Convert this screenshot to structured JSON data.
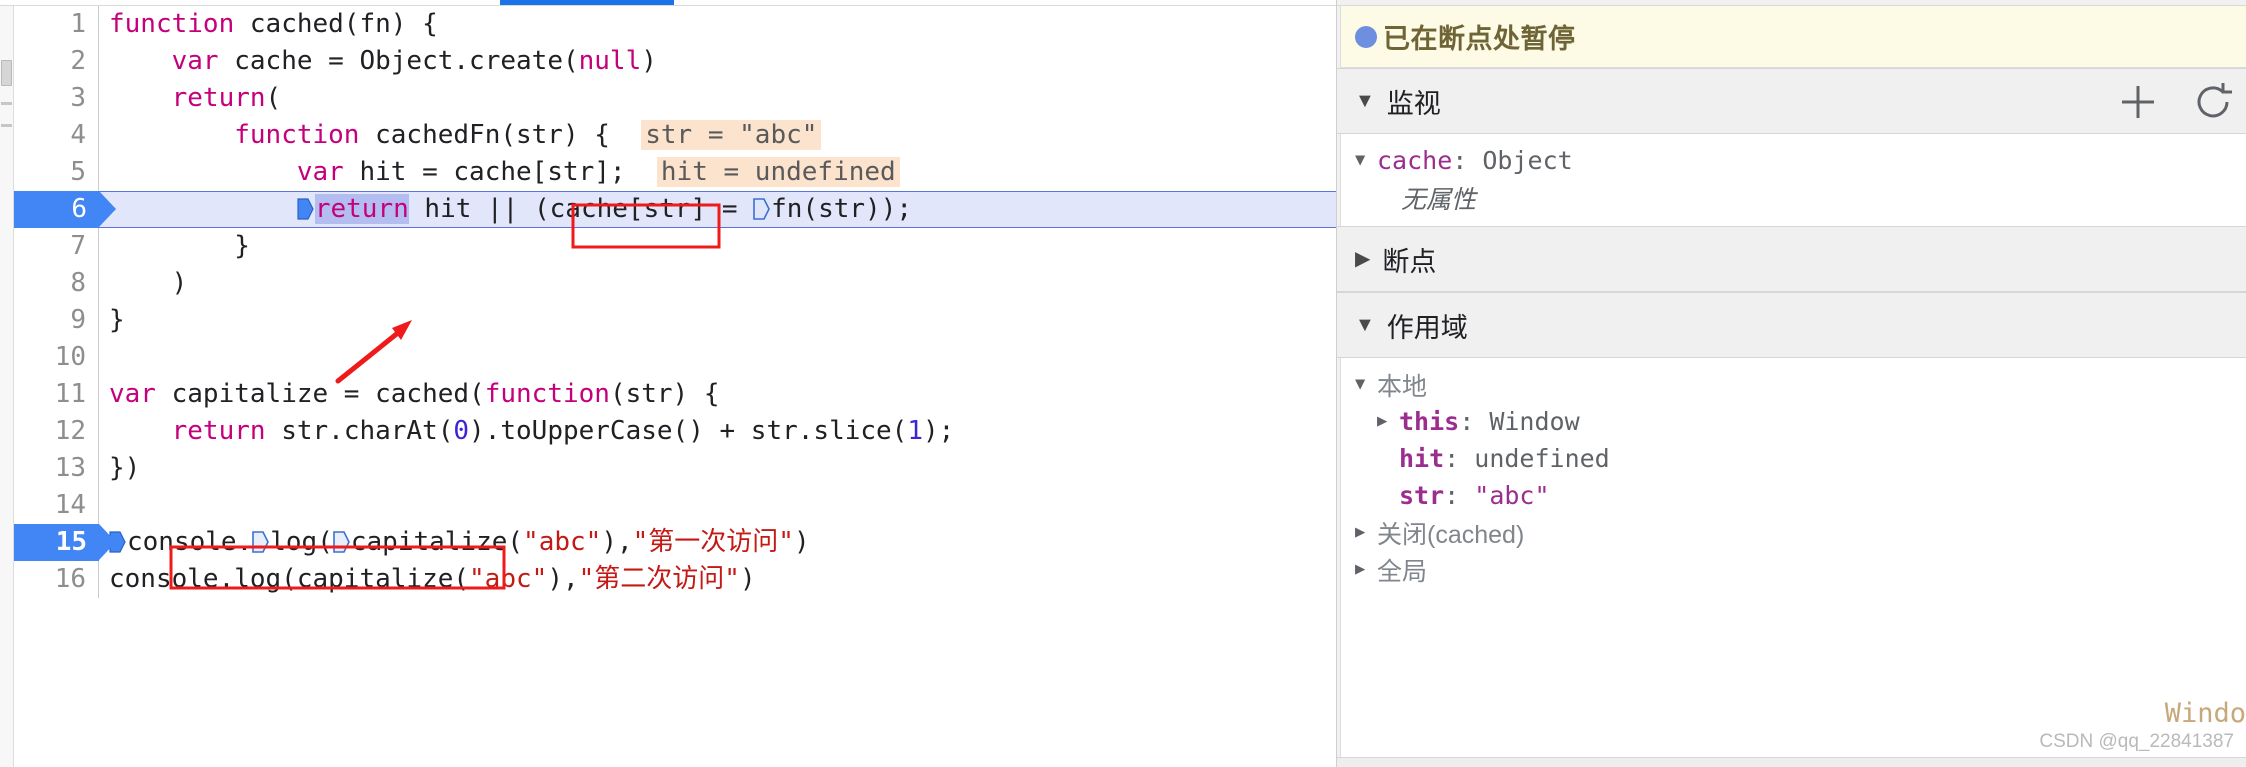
{
  "editor": {
    "language": "javascript",
    "execution_line": 6,
    "breakpoint_lines": [
      6,
      15
    ],
    "lines": [
      {
        "n": "1",
        "text": "function cached(fn) {"
      },
      {
        "n": "2",
        "text": "    var cache = Object.create(null)"
      },
      {
        "n": "3",
        "text": "    return("
      },
      {
        "n": "4",
        "text": "        function cachedFn(str) {",
        "hint": "str = \"abc\""
      },
      {
        "n": "5",
        "text": "            var hit = cache[str];",
        "hint": "hit = undefined"
      },
      {
        "n": "6",
        "text": "            return hit || (cache[str] = fn(str));"
      },
      {
        "n": "7",
        "text": "        }"
      },
      {
        "n": "8",
        "text": "    )"
      },
      {
        "n": "9",
        "text": "}"
      },
      {
        "n": "10",
        "text": ""
      },
      {
        "n": "11",
        "text": "var capitalize = cached(function(str) {"
      },
      {
        "n": "12",
        "text": "    return str.charAt(0).toUpperCase() + str.slice(1);"
      },
      {
        "n": "13",
        "text": "})"
      },
      {
        "n": "14",
        "text": ""
      },
      {
        "n": "15",
        "text": "console.log(capitalize(\"abc\"),\"第一次访问\")"
      },
      {
        "n": "16",
        "text": "console.log(capitalize(\"abc\"),\"第二次访问\")"
      }
    ],
    "inline_hints": [
      {
        "line": 4,
        "text": "str = \"abc\""
      },
      {
        "line": 5,
        "text": "hit = undefined"
      }
    ],
    "annotations": [
      {
        "name": "red-box-fn-call",
        "line": 6,
        "note": "fn(str)"
      },
      {
        "name": "red-box-console-log",
        "line": 15,
        "note": "console.log(capitalize(\"abc\")"
      },
      {
        "name": "red-arrow",
        "note": "points to toUpperCase() on line 12"
      }
    ]
  },
  "sidebar": {
    "paused_banner": {
      "text": "已在断点处暂停",
      "dot_color": "#6e8fe0",
      "background": "#fdfae5"
    },
    "watch": {
      "title": "监视",
      "add_label": "+",
      "refresh_label": "↻",
      "entries": [
        {
          "name": "cache",
          "separator": ": ",
          "value": "Object",
          "expanded": true,
          "children": [
            {
              "text": "无属性",
              "italic": true
            }
          ]
        }
      ]
    },
    "breakpoints": {
      "title": "断点",
      "expanded": false
    },
    "scope": {
      "title": "作用域",
      "expanded": true,
      "groups": [
        {
          "label": "本地",
          "expanded": true,
          "rows": [
            {
              "twisty": "closed",
              "name": "this",
              "separator": ": ",
              "value": "Window",
              "value_kind": "plain",
              "indent": 1
            },
            {
              "twisty": "blank",
              "name": "hit",
              "separator": ": ",
              "value": "undefined",
              "value_kind": "plain",
              "indent": 1,
              "bold": true
            },
            {
              "twisty": "blank",
              "name": "str",
              "separator": ": ",
              "value": "\"abc\"",
              "value_kind": "string",
              "indent": 1,
              "bold": true
            }
          ]
        },
        {
          "label": "关闭(cached)",
          "expanded": false,
          "rows": []
        },
        {
          "label": "全局",
          "expanded": false,
          "rows": []
        }
      ]
    },
    "global_hint_text": "Windo",
    "watermark": "CSDN @qq_22841387"
  },
  "colors": {
    "accent_blue": "#4285f4",
    "exec_line_bg": "#e2e6fb",
    "hint_bg": "#fbe3ce",
    "keyword": "#c5007c",
    "string": "#c41a16",
    "number": "#3b25d6",
    "annotation_red": "#ef1b1b",
    "paused_bg": "#fdfae5"
  }
}
